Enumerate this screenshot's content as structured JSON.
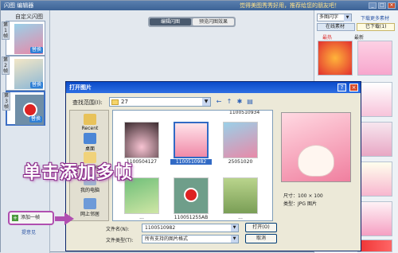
{
  "app": {
    "title": "闪图 编辑器",
    "slogan": "觉得美图秀秀好用，推荐给您的朋友吧！",
    "window_buttons": [
      "_",
      "□",
      "×"
    ]
  },
  "frames_panel": {
    "title": "自定义闪图",
    "frames": [
      {
        "label": "第1帧",
        "replace": "替换"
      },
      {
        "label": "第2帧",
        "replace": "替换"
      },
      {
        "label": "第3帧",
        "replace": "替换"
      }
    ],
    "add_frame": "添加一帧",
    "feedback": "提意见"
  },
  "mode_tabs": [
    {
      "label": "编辑闪图",
      "active": true
    },
    {
      "label": "预览闪图效果",
      "active": false
    }
  ],
  "material_panel": {
    "combo": "多图闪字",
    "download_more": "下载更多素材",
    "tab_online": "在线素材",
    "tab_downloaded": "已下载(1)",
    "hot": "最热",
    "new": "最新"
  },
  "dialog": {
    "title": "打开图片",
    "help": "?",
    "close": "×",
    "lookin_label": "查找范围(I):",
    "lookin_value": "27",
    "toolbar_icons": [
      "back-icon",
      "up-folder-icon",
      "new-folder-icon",
      "view-menu-icon"
    ],
    "places": [
      {
        "label": "Recent",
        "icon": "recent-icon"
      },
      {
        "label": "桌面",
        "icon": "desktop-icon"
      },
      {
        "label": "我的文档",
        "icon": "my-documents-icon"
      },
      {
        "label": "我的电脑",
        "icon": "my-computer-icon"
      },
      {
        "label": "网上邻居",
        "icon": "network-icon"
      }
    ],
    "partial_top_name": "1100510934",
    "files": [
      {
        "name": "1100504127"
      },
      {
        "name": "1100510982",
        "selected": true
      },
      {
        "name": "25051020"
      },
      {
        "name": "..."
      },
      {
        "name": "110051255AB"
      },
      {
        "name": "..."
      }
    ],
    "preview_size": "尺寸：100 × 100",
    "preview_type": "类型：JPG 图片",
    "filename_label": "文件名(N):",
    "filename_value": "1100510982",
    "filetype_label": "文件类型(T):",
    "filetype_value": "所有支持的图片格式",
    "open_button": "打开(O)",
    "cancel_button": "取消"
  },
  "overlay": {
    "caption": "单击添加多帧"
  }
}
